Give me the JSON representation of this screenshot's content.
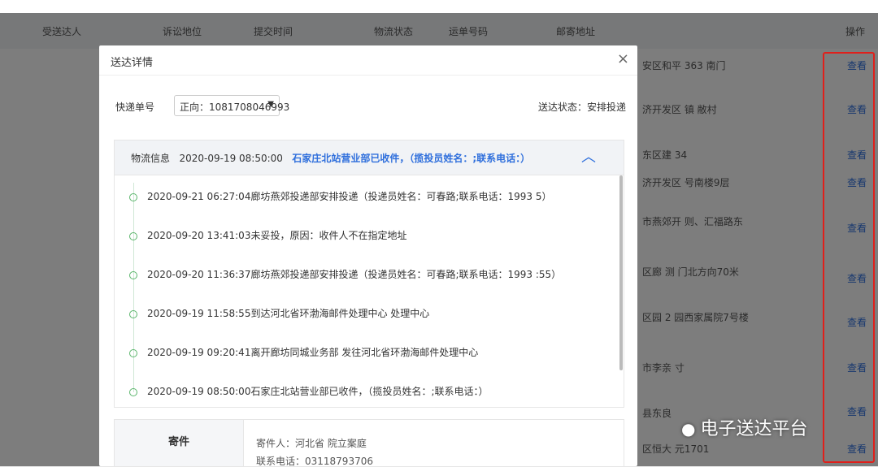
{
  "table": {
    "headers": [
      "受送达人",
      "诉讼地位",
      "提交时间",
      "物流状态",
      "运单号码",
      "邮寄地址",
      "操作"
    ],
    "addresses": [
      "安区和平 363 南门",
      "济开发区 镇 敝村",
      "东区建 34",
      "济开发区 号南楼9层",
      "市燕郊开 则、汇福路东",
      "区廊 测 门北方向70米",
      "区园 2 园西家属院7号楼",
      "市李亲 寸",
      "县东良",
      "区恒大 元1701"
    ],
    "view_label": "查看"
  },
  "modal": {
    "title": "送达详情",
    "close": "×",
    "express_label": "快递单号",
    "express_value": "正向：1081708046993",
    "status_text": "送达状态：安排投递",
    "log_label": "物流信息",
    "log_time": "2020-09-19 08:50:00",
    "log_latest": "石家庄北站营业部已收件，（揽投员姓名：;联系电话：）",
    "toggle": "︿",
    "logs": [
      "2020-09-21 06:27:04廊坊燕郊投递部安排投递（投递员姓名：可春路;联系电话：1993 5）",
      "2020-09-20 13:41:03未妥投，原因：收件人不在指定地址",
      "2020-09-20 11:36:37廊坊燕郊投递部安排投递（投递员姓名：可春路;联系电话：1993 :55）",
      "2020-09-19 11:58:55到达河北省环渤海邮件处理中心 处理中心",
      "2020-09-19 09:20:41离开廊坊同城业务部 发往河北省环渤海邮件处理中心",
      "2020-09-19 08:50:00石家庄北站营业部已收件，（揽投员姓名：;联系电话：）"
    ],
    "send_title": "寄件",
    "sender": "寄件人：河北省 院立案庭",
    "phone": "联系电话：03118793706"
  },
  "watermark": "电子送达平台",
  "colors": {
    "highlight": "#e0201b",
    "link": "#2f6fdc"
  }
}
